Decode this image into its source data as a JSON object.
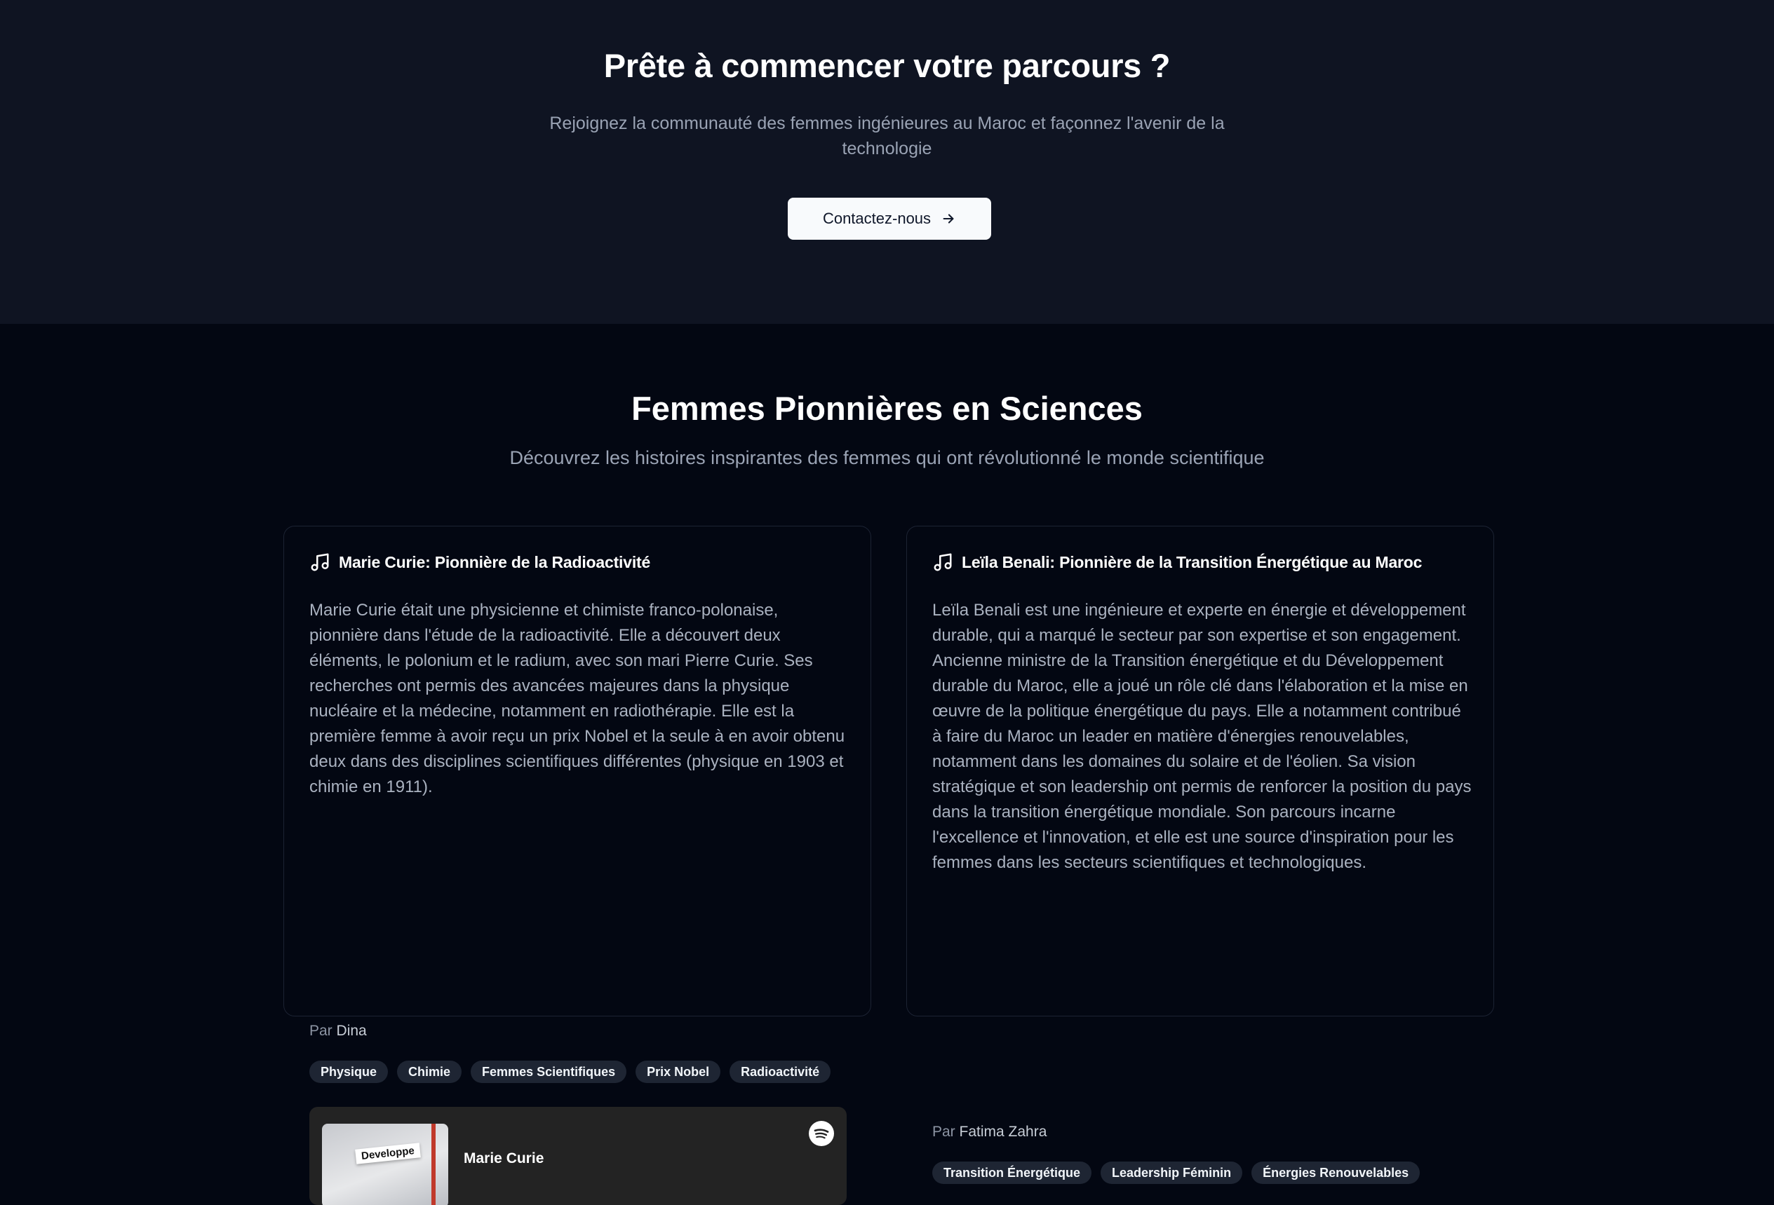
{
  "cta": {
    "title": "Prête à commencer votre parcours ?",
    "subtitle": "Rejoignez la communauté des femmes ingénieures au Maroc et façonnez l'avenir de la technologie",
    "button_label": "Contactez-nous"
  },
  "section": {
    "title": "Femmes Pionnières en Sciences",
    "description": "Découvrez les histoires inspirantes des femmes qui ont révolutionné le monde scientifique"
  },
  "cards": [
    {
      "icon": "music-note-icon",
      "title": "Marie Curie: Pionnière de la Radioactivité",
      "body": "Marie Curie était une physicienne et chimiste franco-polonaise, pionnière dans l'étude de la radioactivité. Elle a découvert deux éléments, le polonium et le radium, avec son mari Pierre Curie. Ses recherches ont permis des avancées majeures dans la physique nucléaire et la médecine, notamment en radiothérapie. Elle est la première femme à avoir reçu un prix Nobel et la seule à en avoir obtenu deux dans des disciplines scientifiques différentes (physique en 1903 et chimie en 1911).",
      "by_prefix": "Par",
      "author": "Dina",
      "tags": [
        "Physique",
        "Chimie",
        "Femmes Scientifiques",
        "Prix Nobel",
        "Radioactivité"
      ],
      "player": {
        "title": "Marie Curie",
        "cover_label": "Developpe",
        "icon": "spotify-icon"
      }
    },
    {
      "icon": "music-note-icon",
      "title": "Leïla Benali: Pionnière de la Transition Énergétique au Maroc",
      "body": "Leïla Benali est une ingénieure et experte en énergie et développement durable, qui a marqué le secteur par son expertise et son engagement. Ancienne ministre de la Transition énergétique et du Développement durable du Maroc, elle a joué un rôle clé dans l'élaboration et la mise en œuvre de la politique énergétique du pays. Elle a notamment contribué à faire du Maroc un leader en matière d'énergies renouvelables, notamment dans les domaines du solaire et de l'éolien. Sa vision stratégique et son leadership ont permis de renforcer la position du pays dans la transition énergétique mondiale. Son parcours incarne l'excellence et l'innovation, et elle est une source d'inspiration pour les femmes dans les secteurs scientifiques et technologiques.",
      "by_prefix": "Par",
      "author": "Fatima Zahra",
      "tags": [
        "Transition Énergétique",
        "Leadership Féminin",
        "Énergies Renouvelables"
      ]
    }
  ]
}
